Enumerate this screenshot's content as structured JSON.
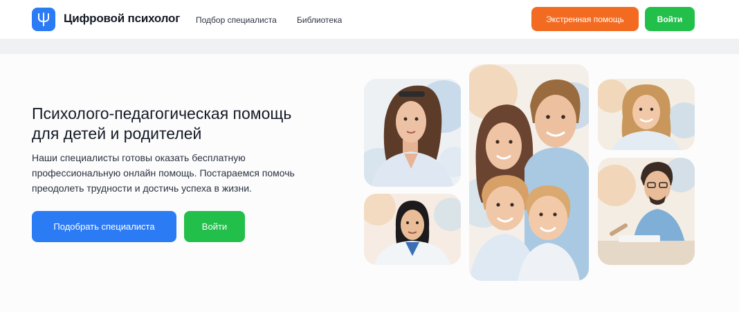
{
  "header": {
    "brand": "Цифровой психолог",
    "logo_icon": "trident-psi-icon",
    "nav": [
      {
        "label": "Подбор специалиста"
      },
      {
        "label": "Библиотека"
      }
    ],
    "emergency_label": "Экстренная помощь",
    "login_label": "Войти"
  },
  "hero": {
    "title": "Психолого-педагогическая помощь для детей и родителей",
    "text": "Наши специалисты готовы оказать бесплатную профессиональную онлайн помощь. Постараемся помочь преодолеть трудности и достичь успеха в жизни.",
    "pick_label": "Подобрать специалиста",
    "login_label": "Войти"
  },
  "photos": [
    {
      "subject": "woman-with-sunglasses-portrait"
    },
    {
      "subject": "female-doctor-portrait"
    },
    {
      "subject": "family-portrait"
    },
    {
      "subject": "smiling-woman-portrait"
    },
    {
      "subject": "man-with-glasses-at-desk-portrait"
    }
  ],
  "colors": {
    "primary_blue": "#2b7bf5",
    "green": "#22bf4b",
    "orange": "#f26b21"
  }
}
